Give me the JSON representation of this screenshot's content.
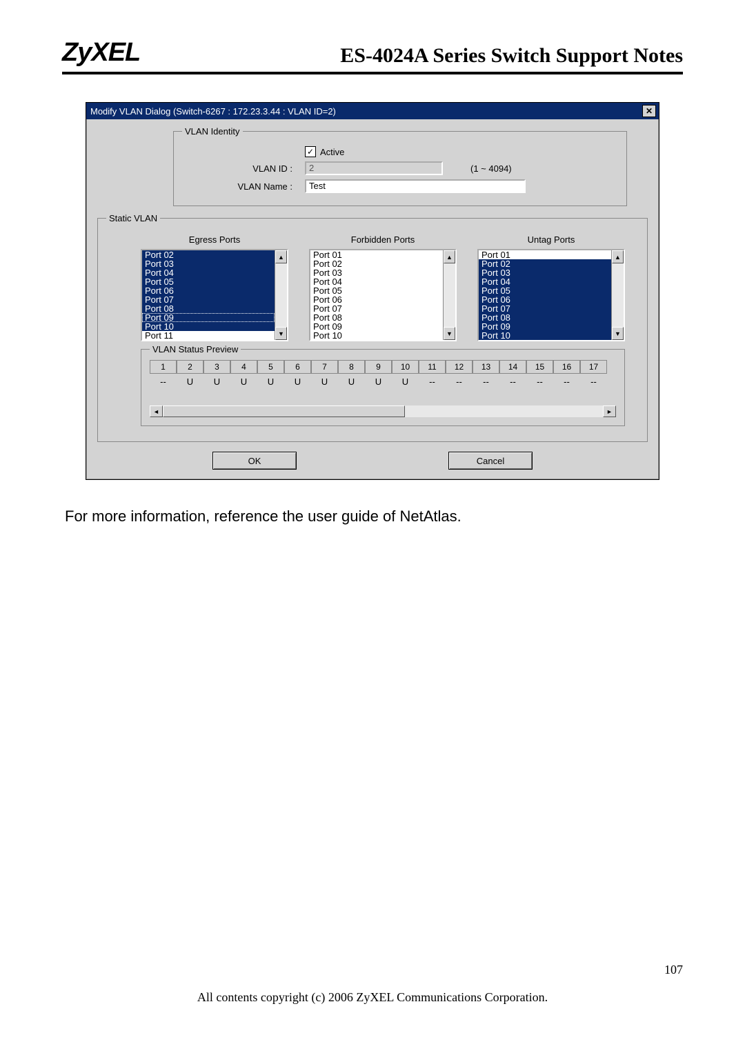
{
  "header": {
    "logo": "ZyXEL",
    "title": "ES-4024A Series Switch Support Notes"
  },
  "dialog": {
    "titlebar": "Modify VLAN Dialog (Switch-6267 : 172.23.3.44 : VLAN ID=2)",
    "identity": {
      "legend": "VLAN Identity",
      "active_label": "Active",
      "active_checked": "✓",
      "vlan_id_label": "VLAN ID :",
      "vlan_id_value": "2",
      "vlan_id_range": "(1 ~ 4094)",
      "vlan_name_label": "VLAN Name :",
      "vlan_name_value": "Test"
    },
    "static": {
      "legend": "Static VLAN",
      "egress_header": "Egress Ports",
      "forbidden_header": "Forbidden Ports",
      "untag_header": "Untag Ports",
      "egress_items": [
        "Port 02",
        "Port 03",
        "Port 04",
        "Port 05",
        "Port 06",
        "Port 07",
        "Port 08",
        "Port 09",
        "Port 10",
        "Port 11"
      ],
      "forbidden_items": [
        "Port 01",
        "Port 02",
        "Port 03",
        "Port 04",
        "Port 05",
        "Port 06",
        "Port 07",
        "Port 08",
        "Port 09",
        "Port 10"
      ],
      "untag_items": [
        "Port 01",
        "Port 02",
        "Port 03",
        "Port 04",
        "Port 05",
        "Port 06",
        "Port 07",
        "Port 08",
        "Port 09",
        "Port 10"
      ],
      "preview_legend": "VLAN Status Preview",
      "preview_ports": [
        "1",
        "2",
        "3",
        "4",
        "5",
        "6",
        "7",
        "8",
        "9",
        "10",
        "11",
        "12",
        "13",
        "14",
        "15",
        "16",
        "17"
      ],
      "preview_values": [
        "--",
        "U",
        "U",
        "U",
        "U",
        "U",
        "U",
        "U",
        "U",
        "U",
        "--",
        "--",
        "--",
        "--",
        "--",
        "--",
        "--"
      ]
    },
    "buttons": {
      "ok": "OK",
      "cancel": "Cancel"
    }
  },
  "body_text": "For more information, reference the user guide of NetAtlas.",
  "footer": {
    "page_number": "107",
    "copyright": "All contents copyright (c) 2006 ZyXEL Communications Corporation."
  }
}
